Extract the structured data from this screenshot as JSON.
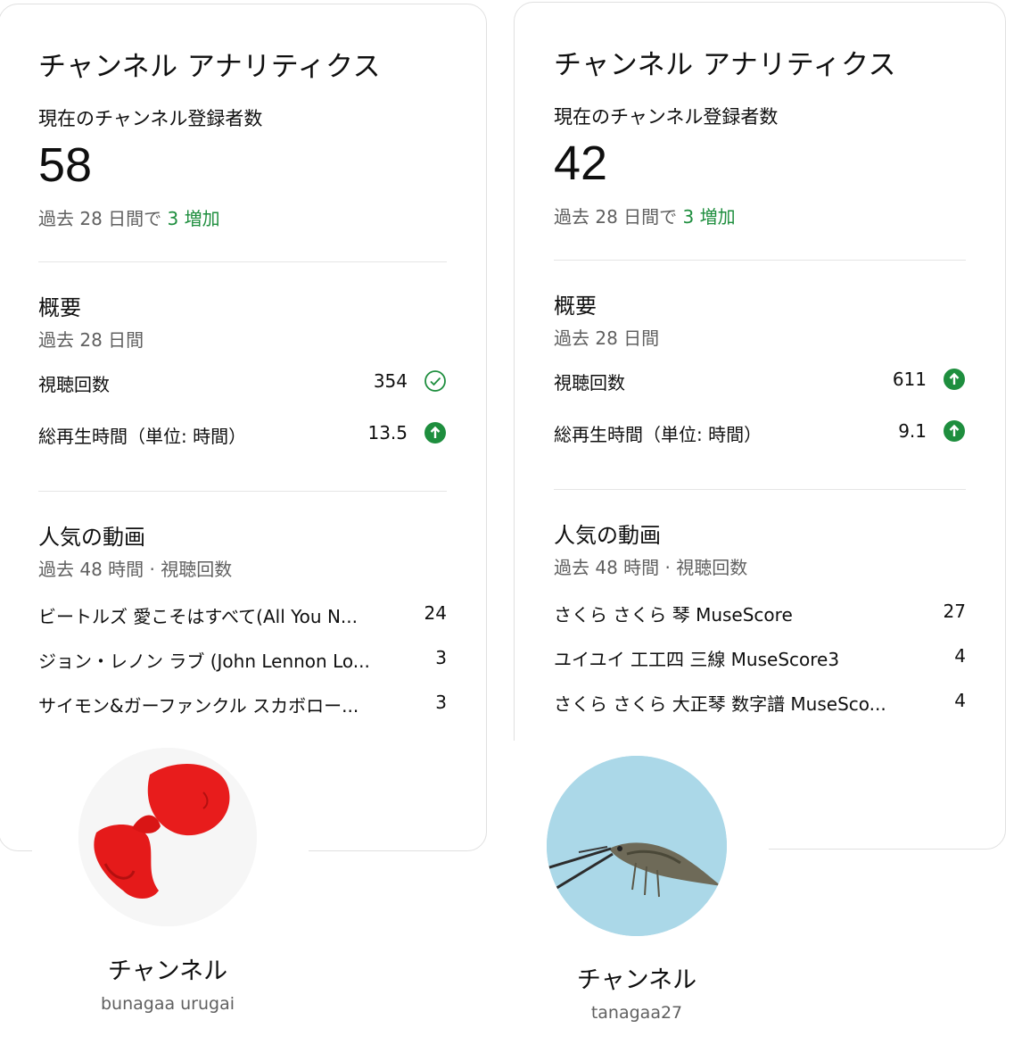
{
  "cards": [
    {
      "title": "チャンネル アナリティクス",
      "subscribers_label": "現在のチャンネル登録者数",
      "subscribers": "58",
      "change_prefix": "過去 28 日間で",
      "change_value": "3 増加",
      "summary_title": "概要",
      "summary_period": "過去 28 日間",
      "metrics": [
        {
          "label": "視聴回数",
          "value": "354",
          "icon": "check-circle-icon"
        },
        {
          "label": "総再生時間（単位: 時間）",
          "value": "13.5",
          "icon": "arrow-up-circle-icon"
        }
      ],
      "popular_title": "人気の動画",
      "popular_period": "過去 48 時間 · 視聴回数",
      "videos": [
        {
          "title": "ビートルズ 愛こそはすべて(All You N...",
          "views": "24"
        },
        {
          "title": "ジョン・レノン ラブ (John Lennon Lo...",
          "views": "3"
        },
        {
          "title": "サイモン&ガーファンクル スカボロー...",
          "views": "3"
        }
      ]
    },
    {
      "title": "チャンネル アナリティクス",
      "subscribers_label": "現在のチャンネル登録者数",
      "subscribers": "42",
      "change_prefix": "過去 28 日間で",
      "change_value": "3 増加",
      "summary_title": "概要",
      "summary_period": "過去 28 日間",
      "metrics": [
        {
          "label": "視聴回数",
          "value": "611",
          "icon": "arrow-up-circle-icon"
        },
        {
          "label": "総再生時間（単位: 時間）",
          "value": "9.1",
          "icon": "arrow-up-circle-icon"
        }
      ],
      "popular_title": "人気の動画",
      "popular_period": "過去 48 時間 · 視聴回数",
      "videos": [
        {
          "title": "さくら さくら 琴 MuseScore",
          "views": "27"
        },
        {
          "title": "ユイユイ 工工四 三線 MuseScore3",
          "views": "4"
        },
        {
          "title": "さくら さくら 大正琴 数字譜 MuseSco...",
          "views": "4"
        }
      ]
    }
  ],
  "channels": [
    {
      "name": "チャンネル",
      "handle": "bunagaa urugai"
    },
    {
      "name": "チャンネル",
      "handle": "tanagaa27"
    }
  ],
  "colors": {
    "green": "#1e8e3e",
    "text": "#0f0f0f",
    "secondary": "#606060"
  }
}
